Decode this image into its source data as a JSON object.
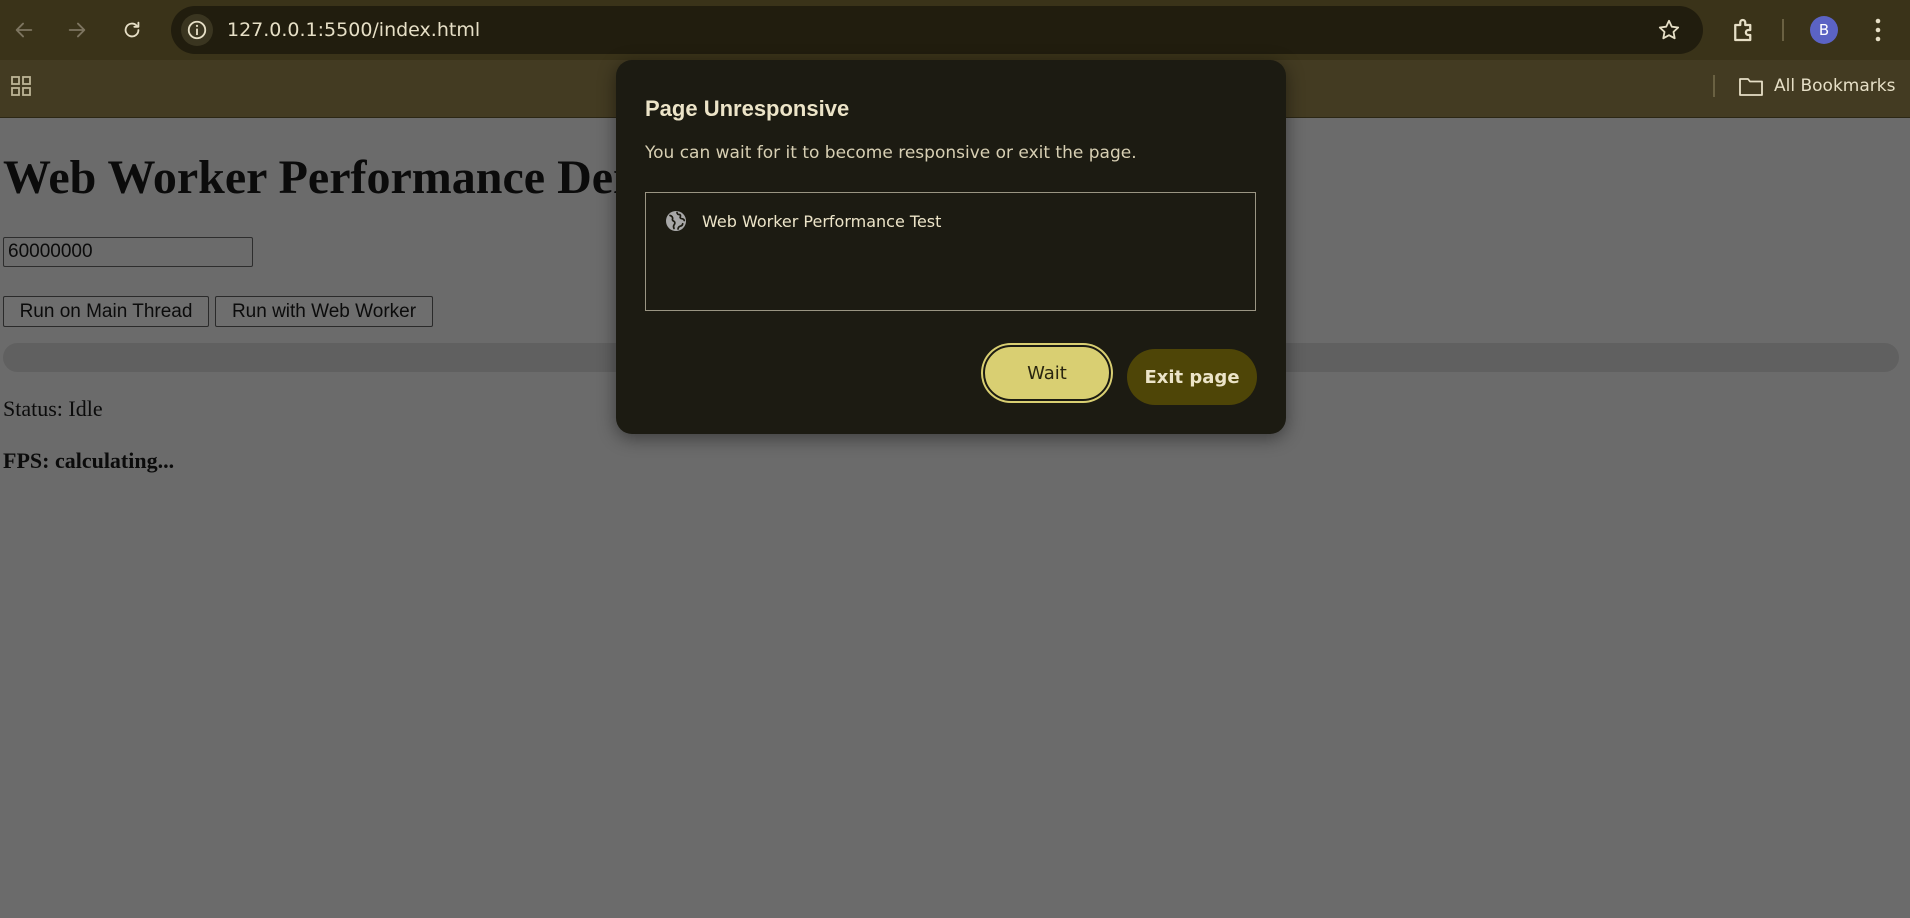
{
  "browser": {
    "url": "127.0.0.1:5500/index.html",
    "profile_initial": "B",
    "bookmarks_folder_label": "All Bookmarks",
    "icons": [
      "back-icon",
      "forward-icon",
      "reload-icon",
      "site-info-icon",
      "bookmark-star-icon",
      "extensions-icon",
      "avatar",
      "kebab-menu-icon",
      "apps-grid-icon",
      "folder-icon"
    ]
  },
  "page": {
    "title": "Web Worker Performance Demo",
    "number_input_value": "60000000",
    "run_main_label": "Run on Main Thread",
    "run_worker_label": "Run with Web Worker",
    "progress_percent": 0,
    "status_text": "Status: Idle",
    "fps_text": "FPS: calculating..."
  },
  "dialog": {
    "title": "Page Unresponsive",
    "description": "You can wait for it to become responsive or exit the page.",
    "pages": [
      {
        "label": "Web Worker Performance Test",
        "icon": "globe-icon"
      }
    ],
    "wait_label": "Wait",
    "exit_label": "Exit page"
  },
  "colors": {
    "chrome_top": "#3a3319",
    "chrome_bookmarks": "#433b22",
    "page_scrim": "#6b6b6b",
    "dialog_bg": "#1c1b12",
    "wait_button": "#d9cf72",
    "exit_button": "#4e4507",
    "avatar": "#5b63c4"
  }
}
